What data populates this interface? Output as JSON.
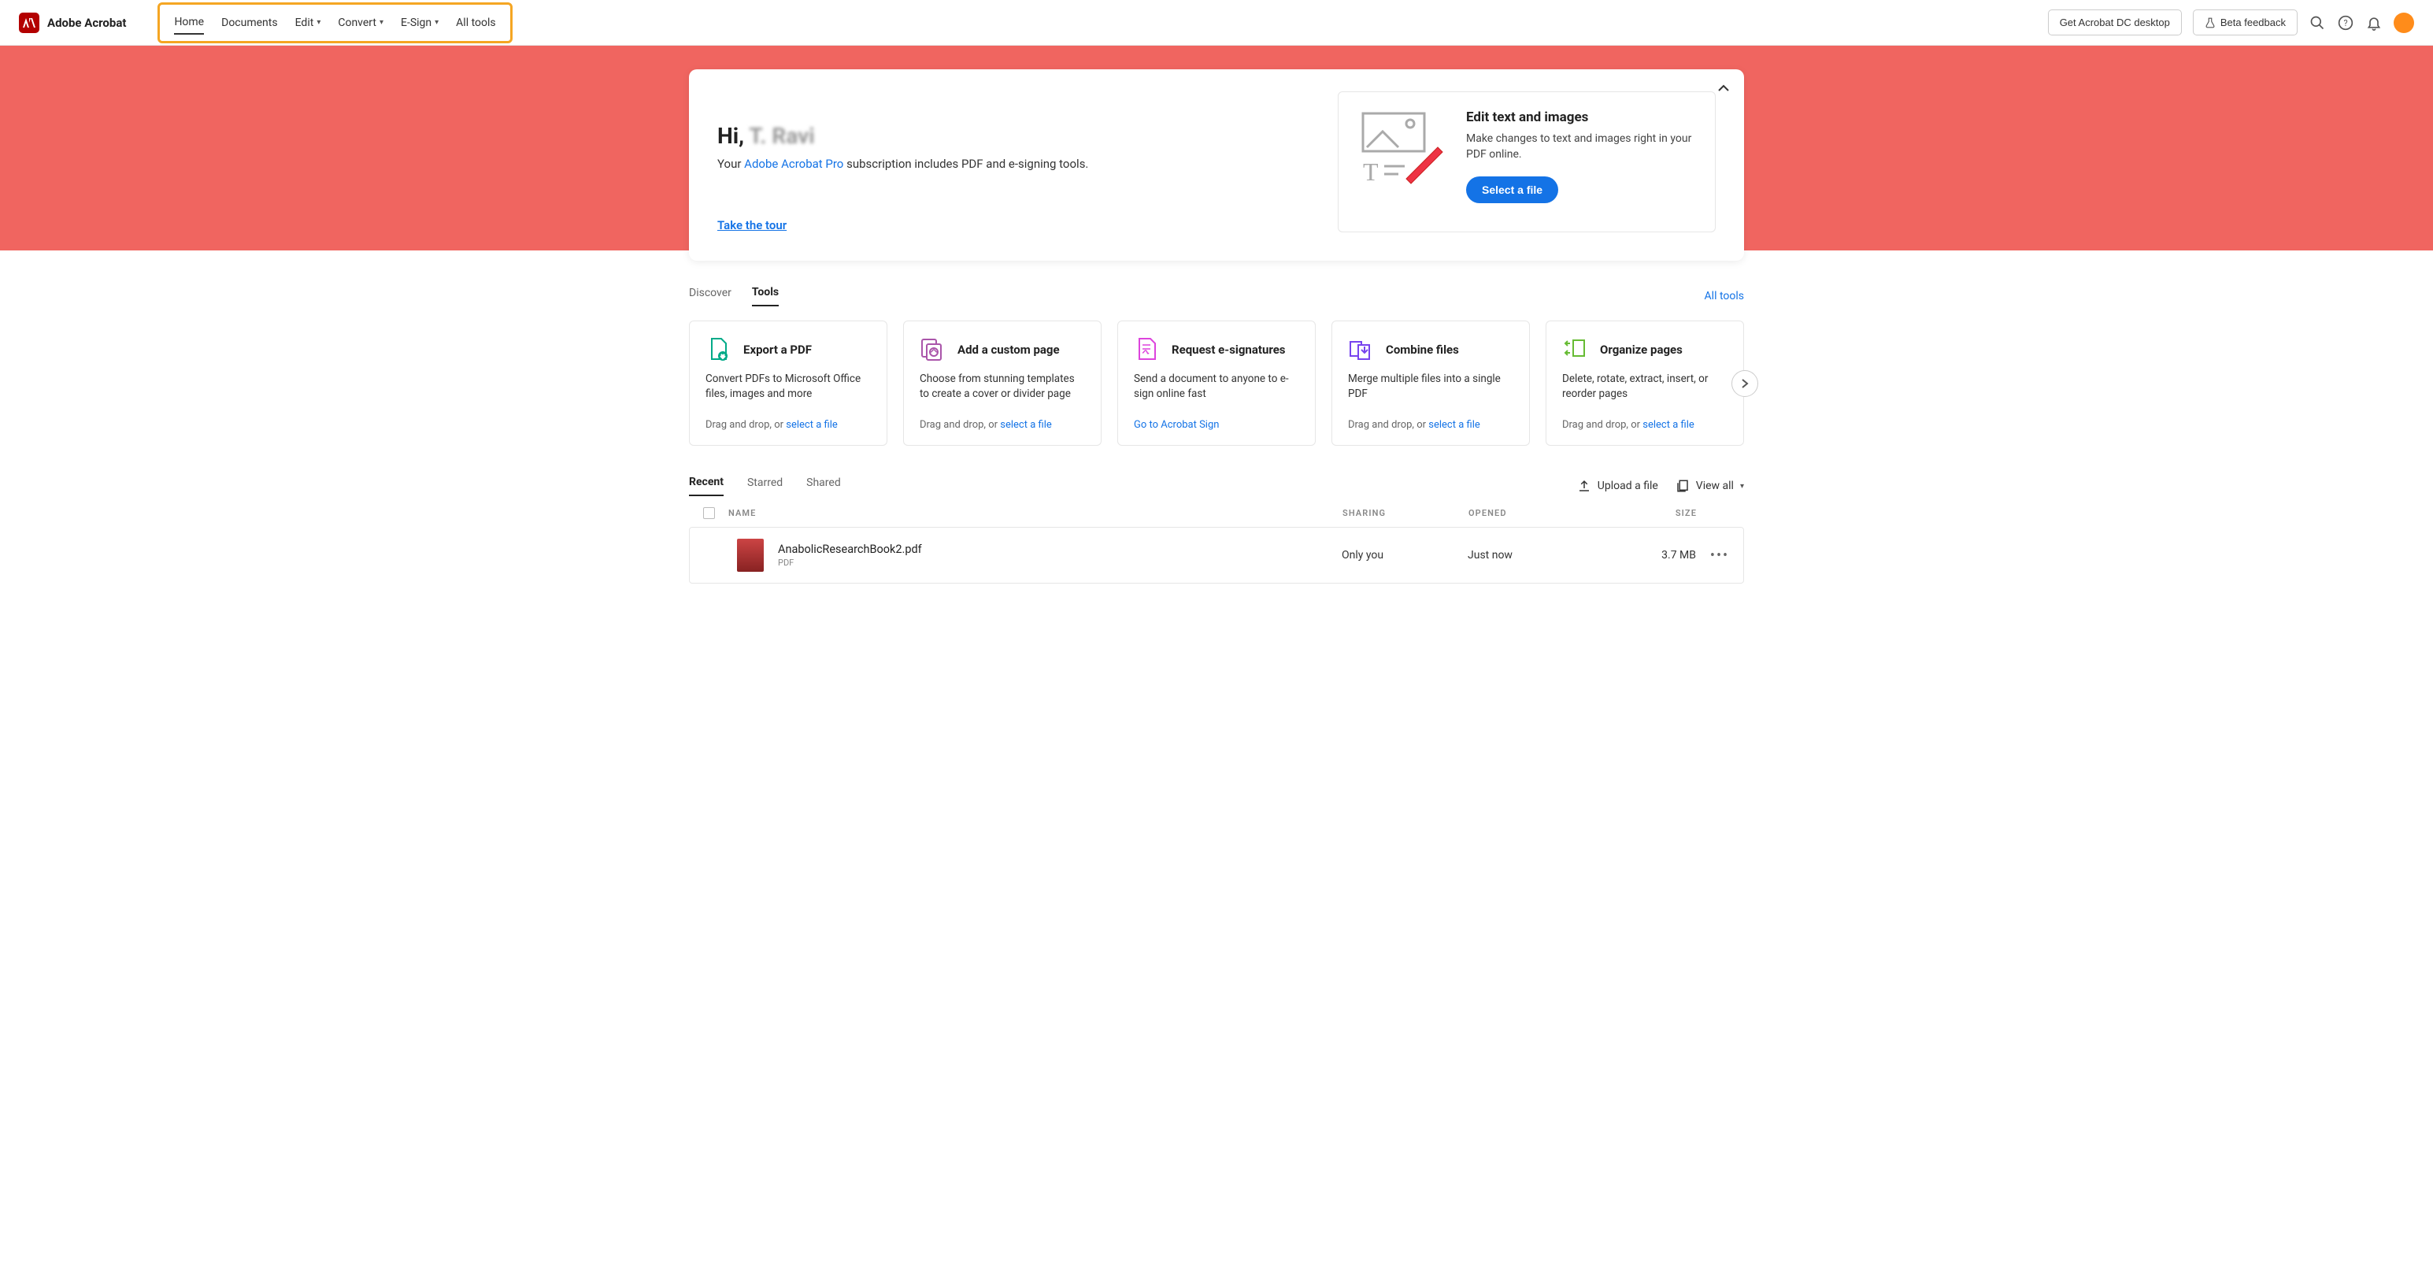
{
  "brand": "Adobe Acrobat",
  "nav": {
    "items": [
      {
        "label": "Home",
        "active": true,
        "dropdown": false
      },
      {
        "label": "Documents",
        "dropdown": false
      },
      {
        "label": "Edit",
        "dropdown": true
      },
      {
        "label": "Convert",
        "dropdown": true
      },
      {
        "label": "E-Sign",
        "dropdown": true
      },
      {
        "label": "All tools",
        "dropdown": false
      }
    ]
  },
  "header_buttons": {
    "desktop": "Get Acrobat DC desktop",
    "beta": "Beta feedback"
  },
  "hero": {
    "greet_prefix": "Hi, ",
    "greet_name": "T. Ravi",
    "sub_prefix": "Your ",
    "sub_link": "Adobe Acrobat Pro",
    "sub_suffix": " subscription includes PDF and e-signing tools.",
    "tour": "Take the tour",
    "promo_title": "Edit text and images",
    "promo_desc": "Make changes to text and images right in your PDF online.",
    "promo_cta": "Select a file"
  },
  "section_tabs": {
    "items": [
      "Discover",
      "Tools"
    ],
    "active": "Tools",
    "all_tools": "All tools"
  },
  "tools": [
    {
      "title": "Export a PDF",
      "desc": "Convert PDFs to Microsoft Office files, images and more",
      "action_prefix": "Drag and drop, or ",
      "action_link": "select a file",
      "icon": "export"
    },
    {
      "title": "Add a custom page",
      "desc": "Choose from stunning templates to create a cover or divider page",
      "action_prefix": "Drag and drop, or ",
      "action_link": "select a file",
      "icon": "custom-page"
    },
    {
      "title": "Request e-signatures",
      "desc": "Send a document to anyone to e-sign online fast",
      "action_prefix": "",
      "action_link": "Go to Acrobat Sign",
      "icon": "esign"
    },
    {
      "title": "Combine files",
      "desc": "Merge multiple files into a single PDF",
      "action_prefix": "Drag and drop, or ",
      "action_link": "select a file",
      "icon": "combine"
    },
    {
      "title": "Organize pages",
      "desc": "Delete, rotate, extract, insert, or reorder pages",
      "action_prefix": "Drag and drop, or ",
      "action_link": "select a file",
      "icon": "organize"
    }
  ],
  "recent_tabs": {
    "items": [
      "Recent",
      "Starred",
      "Shared"
    ],
    "active": "Recent",
    "upload": "Upload a file",
    "viewall": "View all"
  },
  "table": {
    "headers": {
      "name": "NAME",
      "sharing": "SHARING",
      "opened": "OPENED",
      "size": "SIZE"
    },
    "rows": [
      {
        "name": "AnabolicResearchBook2.pdf",
        "type": "PDF",
        "sharing": "Only you",
        "opened": "Just now",
        "size": "3.7 MB"
      }
    ]
  }
}
